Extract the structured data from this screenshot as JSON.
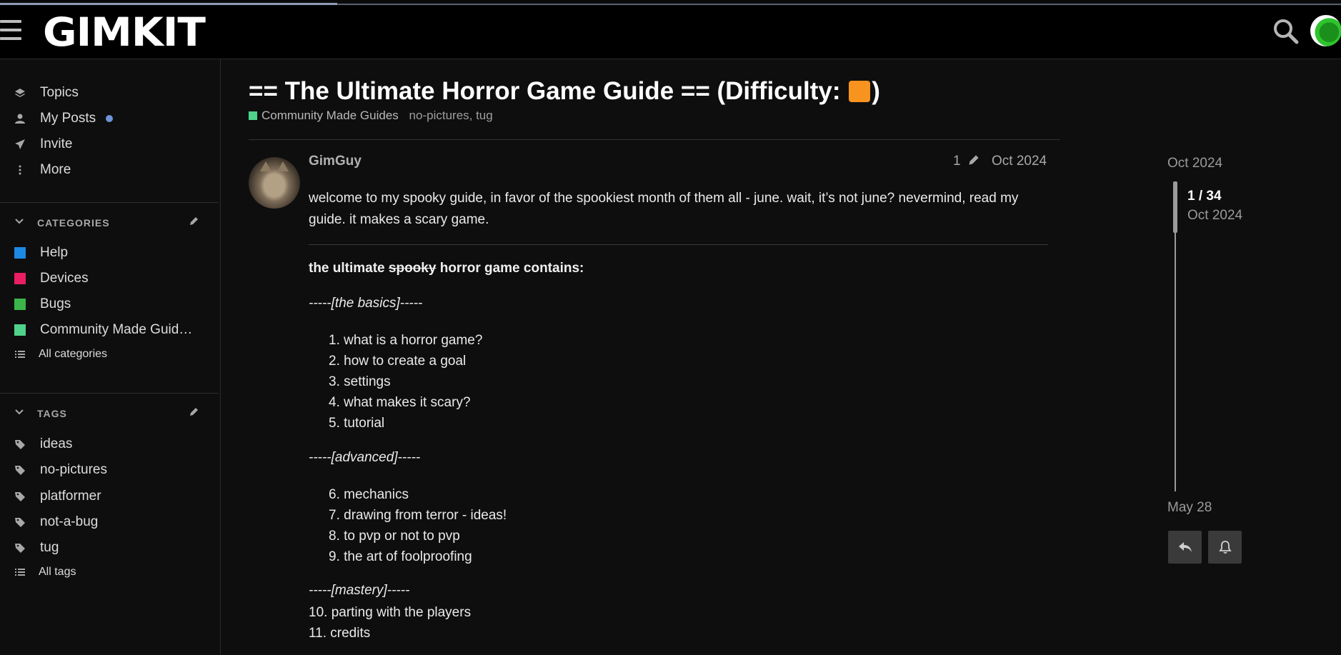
{
  "header": {
    "logo": "GIMKIT"
  },
  "sidebar": {
    "nav": [
      {
        "label": "Topics"
      },
      {
        "label": "My Posts"
      },
      {
        "label": "Invite"
      },
      {
        "label": "More"
      }
    ],
    "categories": {
      "title": "CATEGORIES",
      "items": [
        {
          "label": "Help",
          "color": "#1e88e5"
        },
        {
          "label": "Devices",
          "color": "#e91e63"
        },
        {
          "label": "Bugs",
          "color": "#3bb54a"
        },
        {
          "label": "Community Made Guid…",
          "color": "#4fd38a"
        }
      ],
      "all_label": "All categories"
    },
    "tags": {
      "title": "TAGS",
      "items": [
        {
          "label": "ideas"
        },
        {
          "label": "no-pictures"
        },
        {
          "label": "platformer"
        },
        {
          "label": "not-a-bug"
        },
        {
          "label": "tug"
        }
      ],
      "all_label": "All tags"
    }
  },
  "topic": {
    "title_before": "== The Ultimate Horror Game Guide == (Difficulty: ",
    "title_after": ")",
    "difficulty_color": "#f7931e",
    "category": "Community Made Guides",
    "tags": "no-pictures, tug"
  },
  "post": {
    "username": "GimGuy",
    "edit_count": "1",
    "date": "Oct 2024",
    "intro": "welcome to my spooky guide, in favor of the spookiest month of them all - june. wait, it’s not june? nevermind, read my guide. it makes a scary game.",
    "heading_start": "the ultimate ",
    "heading_struck": "spooky",
    "heading_end": " horror game contains:",
    "basics_header": "-----[the basics]-----",
    "basics": [
      "1. what is a horror game?",
      "2. how to create a goal",
      "3. settings",
      "4. what makes it scary?",
      "5. tutorial"
    ],
    "advanced_header": "-----[advanced]-----",
    "advanced": [
      "6. mechanics",
      "7. drawing from terror - ideas!",
      "8. to pvp or not to pvp",
      "9. the art of foolproofing"
    ],
    "mastery_header": "-----[mastery]-----",
    "mastery": [
      "10. parting with the players",
      "11. credits"
    ]
  },
  "timeline": {
    "start_date": "Oct 2024",
    "position": "1 / 34",
    "position_date": "Oct 2024",
    "end_date": "May 28"
  }
}
